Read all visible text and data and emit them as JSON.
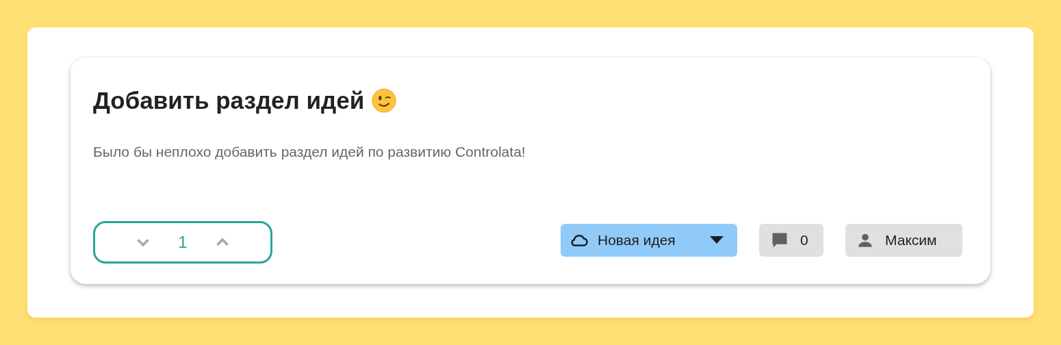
{
  "idea": {
    "title": "Добавить раздел идей",
    "description": "Было бы неплохо добавить раздел идей по развитию Controlata!",
    "votes": "1",
    "status": "Новая идея",
    "comments": "0",
    "author": "Максим"
  }
}
